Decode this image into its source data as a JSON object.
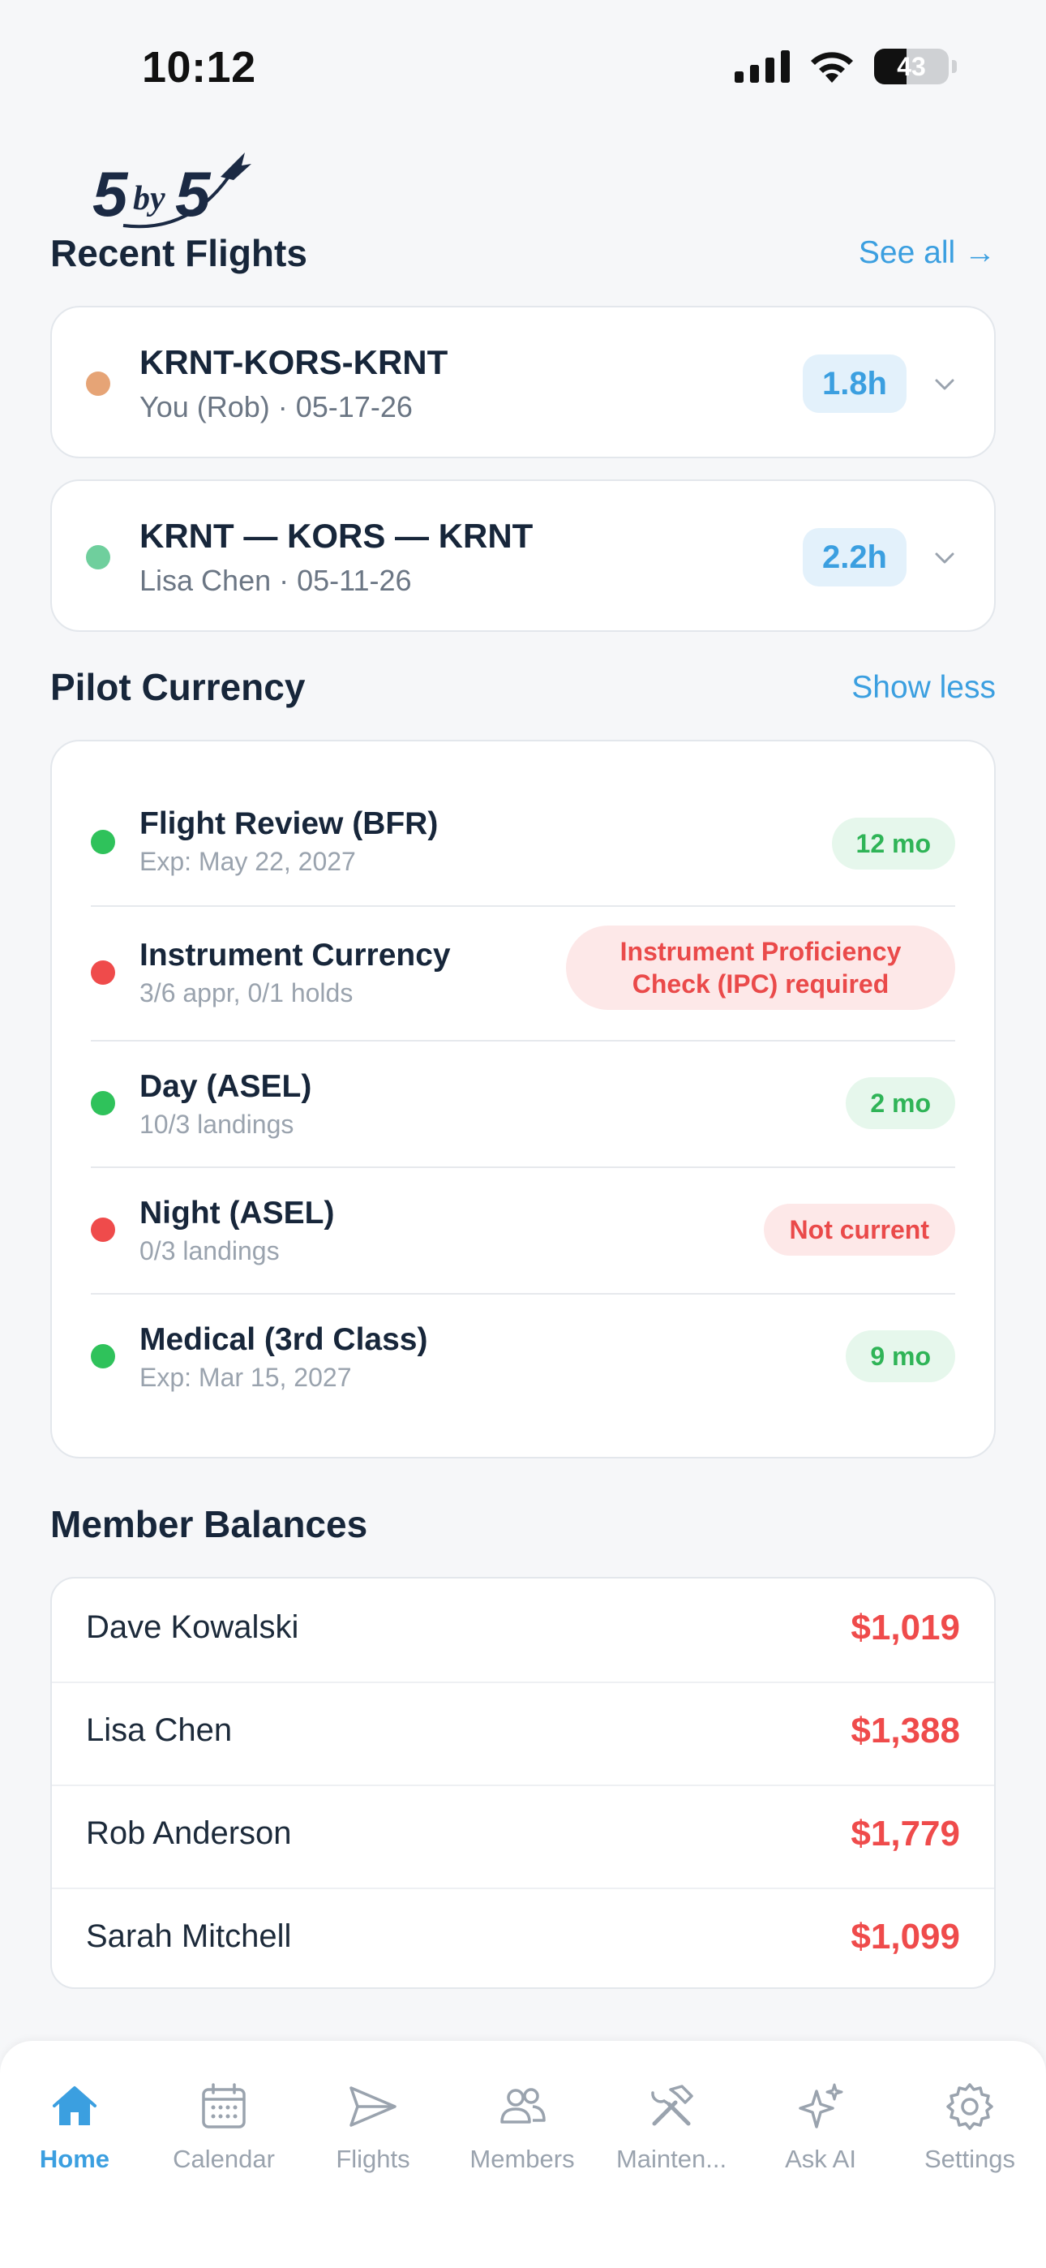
{
  "status_bar": {
    "time": "10:12",
    "battery": "43"
  },
  "logo": {
    "text": "5by5"
  },
  "recent_flights": {
    "title": "Recent Flights",
    "see_all": "See all →",
    "items": [
      {
        "route": "KRNT-KORS-KRNT",
        "sub": "You (Rob) · 05-17-26",
        "hours": "1.8h",
        "dot_color": "#e6a476"
      },
      {
        "route": "KRNT — KORS — KRNT",
        "sub": "Lisa Chen · 05-11-26",
        "hours": "2.2h",
        "dot_color": "#6fcf9d"
      }
    ]
  },
  "pilot_currency": {
    "title": "Pilot Currency",
    "toggle": "Show less",
    "items": [
      {
        "title": "Flight Review (BFR)",
        "sub": "Exp: May 22, 2027",
        "status": "12 mo",
        "state": "green"
      },
      {
        "title": "Instrument Currency",
        "sub": "3/6 appr, 0/1 holds",
        "status_line1": "Instrument Proficiency",
        "status_line2": "Check (IPC) required",
        "state": "red"
      },
      {
        "title": "Day (ASEL)",
        "sub": "10/3 landings",
        "status": "2 mo",
        "state": "green"
      },
      {
        "title": "Night (ASEL)",
        "sub": "0/3 landings",
        "status": "Not current",
        "state": "red"
      },
      {
        "title": "Medical (3rd Class)",
        "sub": "Exp: Mar 15, 2027",
        "status": "9 mo",
        "state": "green"
      }
    ]
  },
  "member_balances": {
    "title": "Member Balances",
    "items": [
      {
        "name": "Dave Kowalski",
        "amount": "$1,019"
      },
      {
        "name": "Lisa Chen",
        "amount": "$1,388"
      },
      {
        "name": "Rob Anderson",
        "amount": "$1,779"
      },
      {
        "name": "Sarah Mitchell",
        "amount": "$1,099"
      }
    ]
  },
  "tabs": [
    {
      "label": "Home",
      "icon": "home-icon",
      "active": true
    },
    {
      "label": "Calendar",
      "icon": "calendar-icon"
    },
    {
      "label": "Flights",
      "icon": "paper-plane-icon"
    },
    {
      "label": "Members",
      "icon": "people-icon"
    },
    {
      "label": "Mainten...",
      "icon": "tools-icon"
    },
    {
      "label": "Ask AI",
      "icon": "sparkles-icon"
    },
    {
      "label": "Settings",
      "icon": "gear-icon"
    }
  ],
  "colors": {
    "accent": "#3b9fe0",
    "green": "#2fb457",
    "red": "#ea4a4a"
  }
}
